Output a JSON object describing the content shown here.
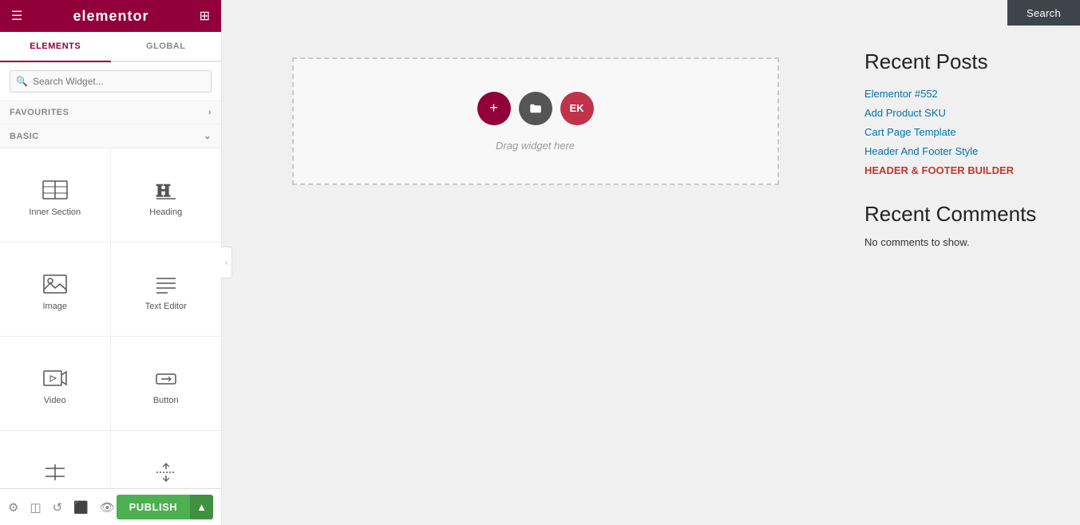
{
  "header": {
    "logo": "elementor",
    "hamburger": "☰",
    "grid": "⊞"
  },
  "panel": {
    "tabs": [
      {
        "label": "ELEMENTS",
        "active": true
      },
      {
        "label": "GLOBAL",
        "active": false
      }
    ],
    "search_placeholder": "Search Widget...",
    "favourites_label": "FAVOURITES",
    "basic_label": "BASIC",
    "widgets": [
      {
        "id": "inner-section",
        "label": "Inner Section"
      },
      {
        "id": "heading",
        "label": "Heading"
      },
      {
        "id": "image",
        "label": "Image"
      },
      {
        "id": "text-editor",
        "label": "Text Editor"
      },
      {
        "id": "video",
        "label": "Video"
      },
      {
        "id": "button",
        "label": "Button"
      },
      {
        "id": "divider",
        "label": "Divider"
      },
      {
        "id": "spacer",
        "label": "Spacer"
      }
    ]
  },
  "bottom_bar": {
    "publish_label": "PUBLISH"
  },
  "canvas": {
    "drag_hint": "Drag widget here"
  },
  "top_bar": {
    "search_label": "Search"
  },
  "right_sidebar": {
    "recent_posts_title": "Recent Posts",
    "links": [
      "Elementor #552",
      "Add Product SKU",
      "Cart Page Template",
      "Header And Footer Style",
      "HEADER & FOOTER BUILDER"
    ],
    "recent_comments_title": "Recent Comments",
    "no_comments": "No comments to show."
  }
}
